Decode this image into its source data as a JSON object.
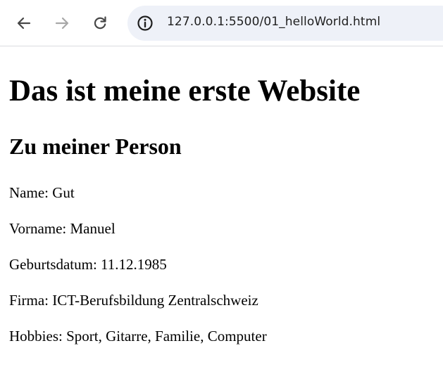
{
  "browser": {
    "url": "127.0.0.1:5500/01_helloWorld.html",
    "icons": {
      "back": "arrow-left-icon",
      "forward": "arrow-right-icon",
      "reload": "reload-icon",
      "site_info": "info-icon"
    }
  },
  "page": {
    "heading": "Das ist meine erste Website",
    "subheading": "Zu meiner Person",
    "lines": [
      "Name: Gut",
      "Vorname: Manuel",
      "Geburtsdatum: 11.12.1985",
      "Firma: ICT-Berufsbildung Zentralschweiz",
      "Hobbies: Sport, Gitarre, Familie, Computer"
    ]
  }
}
